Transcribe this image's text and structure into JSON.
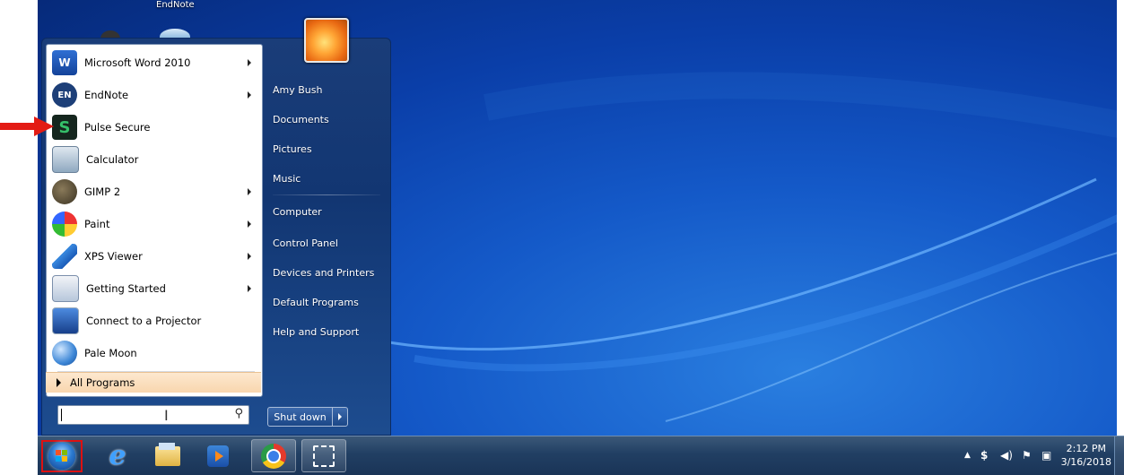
{
  "desktop": {
    "icon_label": "EndNote"
  },
  "start_menu": {
    "programs": [
      {
        "label": "Microsoft Word 2010",
        "icon": "word-icon",
        "has_submenu": true
      },
      {
        "label": "EndNote",
        "icon": "endnote-icon",
        "has_submenu": true
      },
      {
        "label": "Pulse Secure",
        "icon": "pulse-secure-icon",
        "has_submenu": false
      },
      {
        "label": "Calculator",
        "icon": "calculator-icon",
        "has_submenu": false
      },
      {
        "label": "GIMP 2",
        "icon": "gimp-icon",
        "has_submenu": true
      },
      {
        "label": "Paint",
        "icon": "paint-icon",
        "has_submenu": true
      },
      {
        "label": "XPS Viewer",
        "icon": "xps-viewer-icon",
        "has_submenu": true
      },
      {
        "label": "Getting Started",
        "icon": "getting-started-icon",
        "has_submenu": true
      },
      {
        "label": "Connect to a Projector",
        "icon": "projector-icon",
        "has_submenu": false
      },
      {
        "label": "Pale Moon",
        "icon": "pale-moon-icon",
        "has_submenu": false
      }
    ],
    "all_programs": "All Programs",
    "search": {
      "value": ""
    },
    "right_items": [
      {
        "label": "Amy Bush"
      },
      {
        "label": "Documents"
      },
      {
        "label": "Pictures"
      },
      {
        "label": "Music"
      },
      {
        "label": "Computer"
      },
      {
        "label": "Control Panel"
      },
      {
        "label": "Devices and Printers"
      },
      {
        "label": "Default Programs"
      },
      {
        "label": "Help and Support"
      }
    ],
    "shutdown_label": "Shut down"
  },
  "taskbar": {
    "pinned": [
      "internet-explorer-icon",
      "windows-explorer-icon",
      "media-center-icon",
      "chrome-icon",
      "snipping-tool-icon"
    ],
    "tray": {
      "time": "2:12 PM",
      "date": "3/16/2018"
    }
  },
  "colors": {
    "highlight_frame": "#dd1111",
    "arrow": "#e31b14",
    "desktop_blue": "#1459c8"
  }
}
